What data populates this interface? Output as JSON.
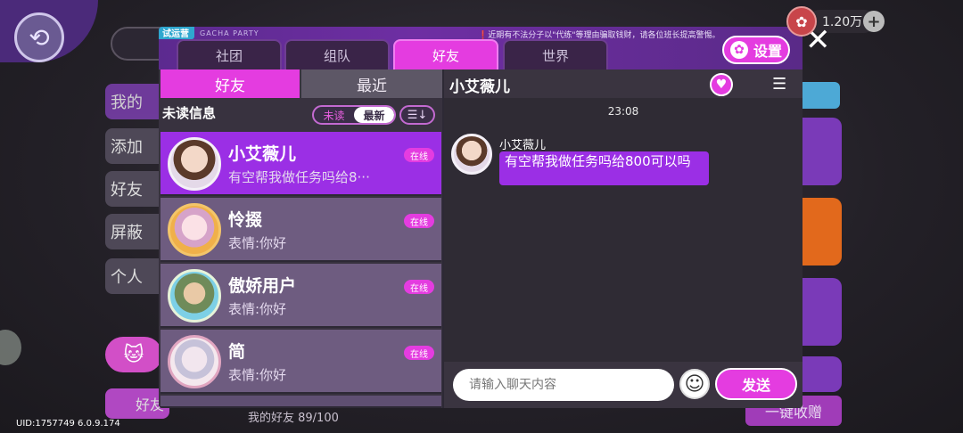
{
  "background": {
    "back_icon": "back-arrow-icon",
    "side_items": [
      "我的",
      "添加",
      "好友",
      "屏蔽",
      "个人"
    ],
    "bottom_left_label": "好友",
    "bottom_right_label": "一键收赠"
  },
  "currency": {
    "value": "1.20万",
    "plus": "+"
  },
  "uid": "UID:1757749 6.0.9.174",
  "close": "✕",
  "panel": {
    "trial_badge": "试运营",
    "brand_small": "GACHA PARTY",
    "notice": "❗近期有不法分子以\"代练\"等理由骗取钱财，请各位班长提高警惕。",
    "tabs": [
      {
        "label": "社团",
        "active": false
      },
      {
        "label": "组队",
        "active": false
      },
      {
        "label": "好友",
        "active": true
      },
      {
        "label": "世界",
        "active": false
      }
    ],
    "settings_label": "设置"
  },
  "left": {
    "subtabs": {
      "friends": "好友",
      "recent": "最近"
    },
    "unread_title": "未读信息",
    "toggle": {
      "unread": "未读",
      "newest": "最新"
    },
    "friends": [
      {
        "name": "小艾薇儿",
        "message": "有空帮我做任务吗给8···",
        "status": "在线"
      },
      {
        "name": "怜掇",
        "message": "表情:你好",
        "status": "在线"
      },
      {
        "name": "傲娇用户",
        "message": "表情:你好",
        "status": "在线"
      },
      {
        "name": "简",
        "message": "表情:你好",
        "status": "在线"
      }
    ],
    "friend_count": "我的好友 89/100"
  },
  "chat": {
    "name": "小艾薇儿",
    "time": "23:08",
    "sender": "小艾薇儿",
    "message": "有空帮我做任务吗给800可以吗",
    "input_placeholder": "请输入聊天内容",
    "send_label": "发送"
  },
  "colors": {
    "accent": "#e43ce0",
    "selected": "#9b2fe5",
    "panel": "#2d2935"
  }
}
